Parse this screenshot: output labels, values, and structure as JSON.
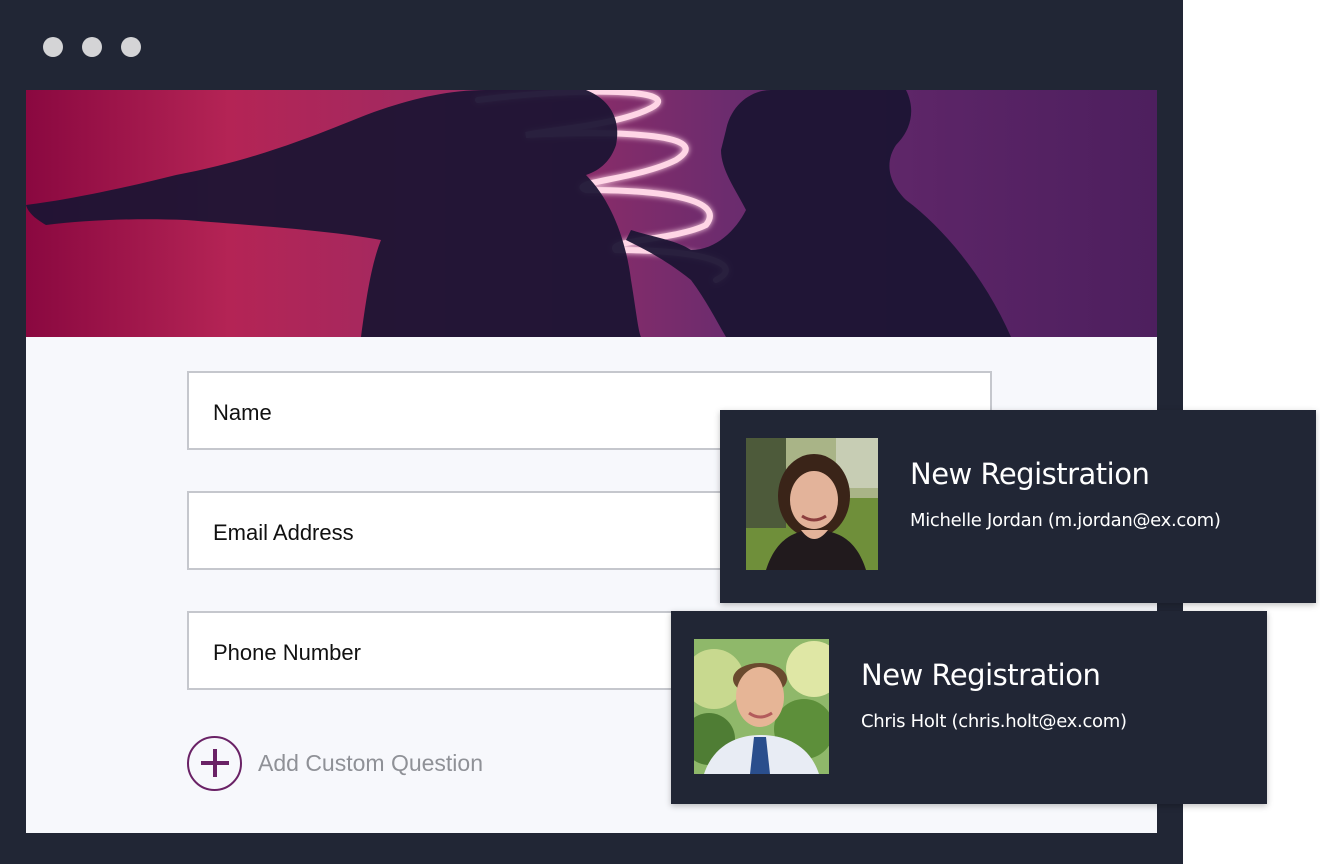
{
  "window": {
    "controls": [
      "close",
      "minimize",
      "maximize"
    ]
  },
  "banner": {
    "image": "event-banner-photo"
  },
  "form": {
    "fields": [
      {
        "label": "Name"
      },
      {
        "label": "Email Address"
      },
      {
        "label": "Phone Number"
      }
    ],
    "add_custom_question_label": "Add Custom Question",
    "accent_color": "#6a2266"
  },
  "notifications": [
    {
      "title": "New Registration",
      "detail": "Michelle Jordan (m.jordan@ex.com)",
      "avatar": "michelle-jordan-photo"
    },
    {
      "title": "New Registration",
      "detail": "Chris Holt (chris.holt@ex.com)",
      "avatar": "chris-holt-photo"
    }
  ]
}
